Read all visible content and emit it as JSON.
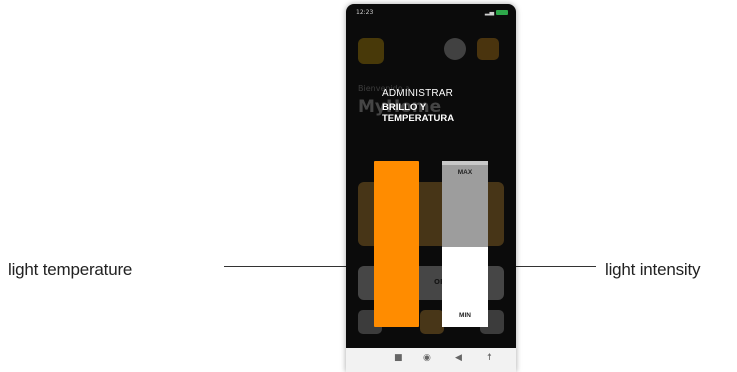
{
  "annotations": {
    "left_label": "light temperature",
    "right_label": "light intensity"
  },
  "status_bar": {
    "time": "12:23"
  },
  "background_app": {
    "welcome": "Bienvenido a",
    "home_title": "MyHome",
    "toggle_text": "OFF"
  },
  "dialog": {
    "title_line1": "ADMINISTRAR",
    "title_line2": "BRILLO Y",
    "title_line3": "TEMPERATURA"
  },
  "temperature_slider": {
    "color": "#ff8c00"
  },
  "intensity_slider": {
    "max_label": "MAX",
    "min_label": "MIN",
    "level_percent": 48,
    "track_color": "#9d9d9d",
    "fill_color": "#ffffff"
  },
  "nav_bar": {
    "icons": [
      "square-icon",
      "circle-icon",
      "back-triangle-icon",
      "accessibility-icon"
    ]
  }
}
